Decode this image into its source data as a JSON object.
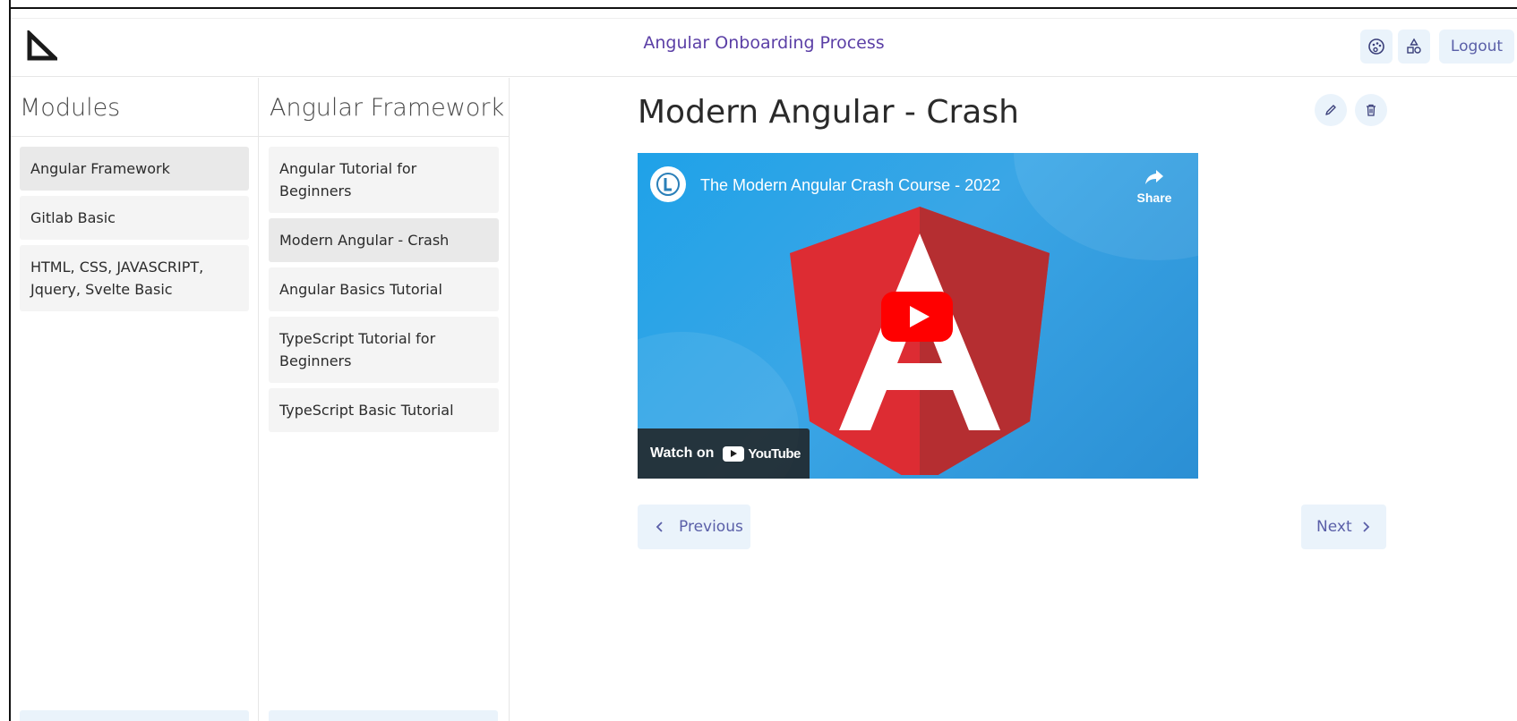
{
  "header": {
    "app_title": "Angular Onboarding Process",
    "logout_label": "Logout",
    "icons": [
      "palette-icon",
      "shapes-icon"
    ]
  },
  "modules": {
    "heading": "Modules",
    "items": [
      {
        "label": "Angular Framework",
        "active": true
      },
      {
        "label": "Gitlab Basic",
        "active": false
      },
      {
        "label": "HTML, CSS, JAVASCRIPT, Jquery, Svelte Basic",
        "active": false
      }
    ]
  },
  "lessons": {
    "heading": "Angular Framework",
    "items": [
      {
        "label": "Angular Tutorial for Beginners",
        "active": false
      },
      {
        "label": "Modern Angular - Crash",
        "active": true
      },
      {
        "label": "Angular Basics Tutorial",
        "active": false
      },
      {
        "label": "TypeScript Tutorial for Beginners",
        "active": false
      },
      {
        "label": "TypeScript Basic Tutorial",
        "active": false
      }
    ]
  },
  "main": {
    "lesson_title": "Modern Angular - Crash",
    "video": {
      "title": "The Modern Angular Crash Course - 2022",
      "share_label": "Share",
      "watch_on": "Watch on",
      "youtube_label": "YouTube"
    },
    "prev_label": "Previous",
    "next_label": "Next"
  },
  "colors": {
    "accent": "#5a5fa8",
    "button_bg": "#eaf3fb",
    "title_purple": "#5b3fa6"
  }
}
